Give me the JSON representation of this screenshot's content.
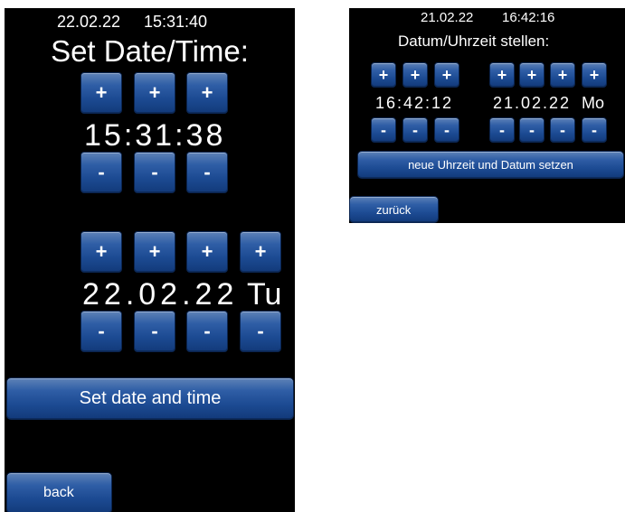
{
  "screen_en": {
    "clock_date": "22.02.22",
    "clock_time": "15:31:40",
    "title": "Set Date/Time:",
    "time_display": "15:31:38",
    "date_display": "22.02.22",
    "weekday": "Tu",
    "plus_label": "+",
    "minus_label": "-",
    "set_button_label": "Set date and time",
    "back_button_label": "back"
  },
  "screen_de": {
    "clock_date": "21.02.22",
    "clock_time": "16:42:16",
    "title": "Datum/Uhrzeit stellen:",
    "time_display": "16:42:12",
    "date_display": "21.02.22",
    "weekday": "Mo",
    "plus_label": "+",
    "minus_label": "-",
    "set_button_label": "neue Uhrzeit und Datum setzen",
    "back_button_label": "zurück"
  },
  "colors": {
    "screen_background": "#000000",
    "button_blue": "#1c4a92",
    "text": "#ffffff"
  },
  "icons": [
    "plus-icon",
    "minus-icon"
  ]
}
